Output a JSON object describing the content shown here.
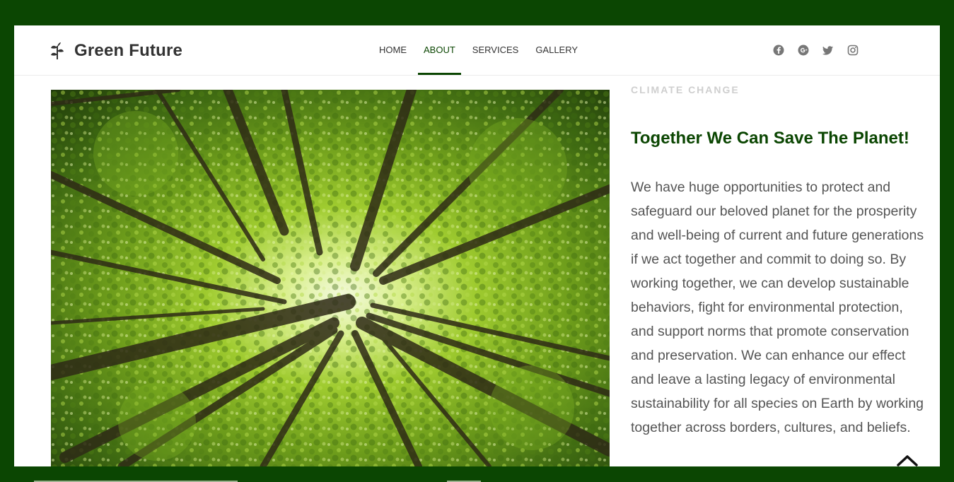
{
  "brand": {
    "name": "Green Future",
    "icon": "sprout-icon"
  },
  "nav": {
    "items": [
      {
        "label": "HOME"
      },
      {
        "label": "ABOUT"
      },
      {
        "label": "SERVICES"
      },
      {
        "label": "GALLERY"
      }
    ],
    "active": "ABOUT"
  },
  "social": {
    "icons": [
      "facebook-icon",
      "google-plus-icon",
      "twitter-icon",
      "instagram-icon"
    ]
  },
  "hero": {
    "image": "forest-canopy-photo"
  },
  "section": {
    "eyebrow": "CLIMATE CHANGE",
    "headline": "Together We Can Save The Planet!",
    "body": "We have huge opportunities to protect and safeguard our beloved planet for the prosperity and well-being of current and future generations if we act together and commit to doing so. By working together, we can develop sustainable behaviors, fight for environmental protection, and support norms that promote conservation and preservation. We can enhance our effect and leave a lasting legacy of environmental sustainability for all species on Earth by working together across borders, cultures, and beliefs."
  },
  "back_to_top": {
    "icon": "chevron-up-icon"
  },
  "colors": {
    "brand_green": "#0b4602",
    "eyebrow_gray": "#cfcfcf",
    "text_gray": "#555555"
  }
}
